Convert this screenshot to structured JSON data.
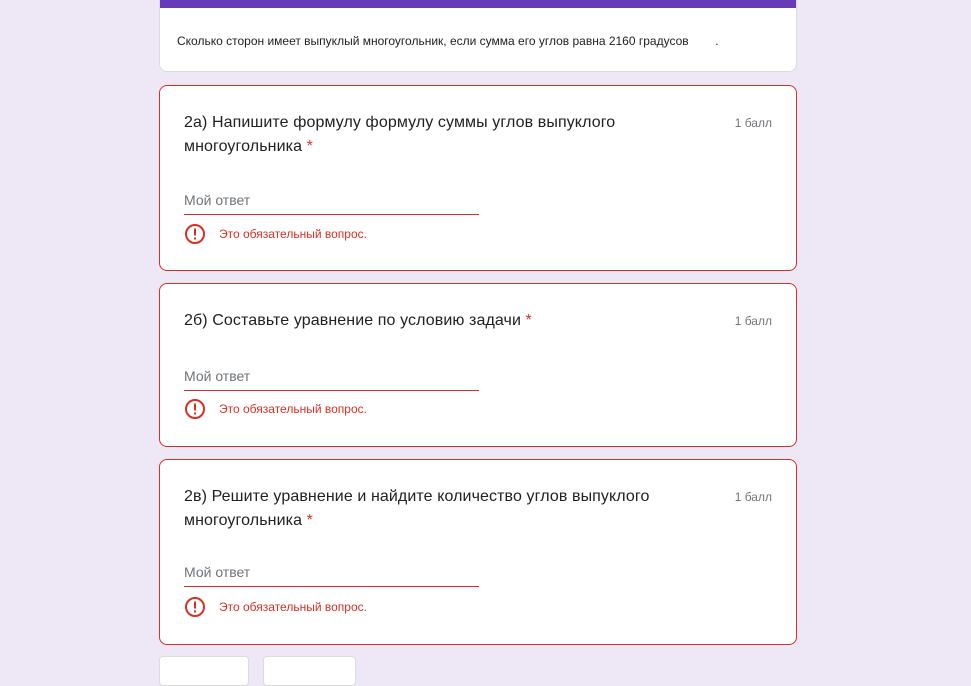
{
  "header": {
    "description": "Сколько сторон имеет выпуклый многоугольник, если сумма его углов равна 2160 градусов        ."
  },
  "questions": [
    {
      "title": "2а) Напишите формулу формулу суммы углов выпуклого многоугольника",
      "required_mark": "*",
      "points": "1 балл",
      "placeholder": "Мой ответ",
      "error": "Это обязательный вопрос."
    },
    {
      "title": "2б) Составьте уравнение по условию задачи",
      "required_mark": "*",
      "points": "1 балл",
      "placeholder": "Мой ответ",
      "error": "Это обязательный вопрос."
    },
    {
      "title": "2в) Решите уравнение и найдите количество углов выпуклого многоугольника",
      "required_mark": "*",
      "points": "1 балл",
      "placeholder": "Мой ответ",
      "error": "Это обязательный вопрос."
    }
  ],
  "colors": {
    "background": "#ede7f6",
    "accent": "#673ab7",
    "error": "#d93025"
  },
  "icons": {
    "error": "error-circle-icon"
  }
}
